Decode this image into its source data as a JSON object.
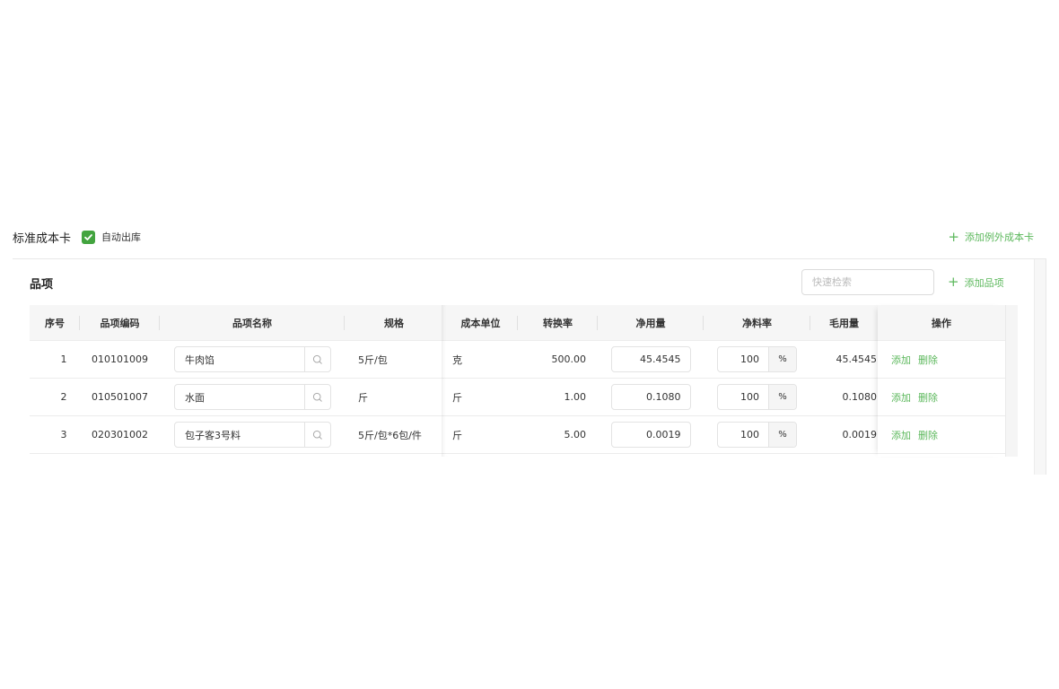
{
  "header": {
    "title": "标准成本卡",
    "auto_outbound_label": "自动出库",
    "auto_outbound_checked": true,
    "add_exception_label": "添加例外成本卡"
  },
  "section": {
    "title": "品项",
    "search_placeholder": "快速检索",
    "add_item_label": "添加品项"
  },
  "columns": {
    "index": "序号",
    "code": "品项编码",
    "name": "品项名称",
    "spec": "规格",
    "cost_unit": "成本单位",
    "conversion": "转换率",
    "net_qty": "净用量",
    "net_rate": "净料率",
    "gross_qty": "毛用量",
    "ops": "操作"
  },
  "rows": [
    {
      "index": "1",
      "code": "010101009",
      "name": "牛肉馅",
      "spec": "5斤/包",
      "cost_unit": "克",
      "conversion": "500.00",
      "net_qty": "45.4545",
      "net_rate": "100",
      "rate_unit": "%",
      "gross_qty": "45.4545",
      "add": "添加",
      "delete": "删除"
    },
    {
      "index": "2",
      "code": "010501007",
      "name": "水面",
      "spec": "斤",
      "cost_unit": "斤",
      "conversion": "1.00",
      "net_qty": "0.1080",
      "net_rate": "100",
      "rate_unit": "%",
      "gross_qty": "0.1080",
      "add": "添加",
      "delete": "删除"
    },
    {
      "index": "3",
      "code": "020301002",
      "name": "包子客3号料",
      "spec": "5斤/包*6包/件",
      "cost_unit": "斤",
      "conversion": "5.00",
      "net_qty": "0.0019",
      "net_rate": "100",
      "rate_unit": "%",
      "gross_qty": "0.0019",
      "add": "添加",
      "delete": "删除"
    }
  ],
  "colors": {
    "accent": "#5cb85c",
    "checkbox": "#43a43f"
  }
}
